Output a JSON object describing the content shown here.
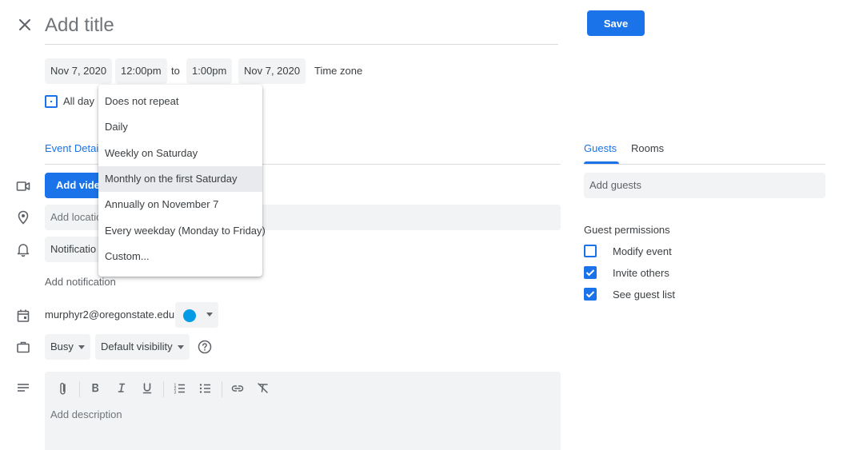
{
  "header": {
    "title_placeholder": "Add title",
    "save_label": "Save"
  },
  "datetime": {
    "start_date": "Nov 7, 2020",
    "start_time": "12:00pm",
    "to_label": "to",
    "end_time": "1:00pm",
    "end_date": "Nov 7, 2020",
    "timezone_label": "Time zone",
    "all_day_label": "All day"
  },
  "repeat_menu": {
    "items": [
      "Does not repeat",
      "Daily",
      "Weekly on Saturday",
      "Monthly on the first Saturday",
      "Annually on November 7",
      "Every weekday (Monday to Friday)",
      "Custom..."
    ],
    "highlighted_index": 3
  },
  "tabs": {
    "event_details": "Event Detai",
    "guests": "Guests",
    "rooms": "Rooms"
  },
  "details": {
    "add_video_label": "Add vide",
    "location_placeholder": "Add locatio",
    "notification_label": "Notificatio",
    "add_notification": "Add notification",
    "calendar_email": "murphyr2@oregonstate.edu",
    "calendar_color": "#039be5",
    "busy_label": "Busy",
    "visibility_label": "Default visibility",
    "description_placeholder": "Add description"
  },
  "guests": {
    "add_guests_placeholder": "Add guests",
    "permissions_title": "Guest permissions",
    "permissions": [
      {
        "label": "Modify event",
        "checked": false
      },
      {
        "label": "Invite others",
        "checked": true
      },
      {
        "label": "See guest list",
        "checked": true
      }
    ]
  },
  "colors": {
    "accent": "#1a73e8",
    "field_bg": "#f1f3f4"
  },
  "icons": {
    "close": "close-icon",
    "video": "video-camera-icon",
    "location": "location-pin-icon",
    "notification": "bell-icon",
    "calendar": "calendar-icon",
    "busy": "briefcase-icon",
    "description": "notes-icon",
    "help": "help-circle-icon"
  }
}
